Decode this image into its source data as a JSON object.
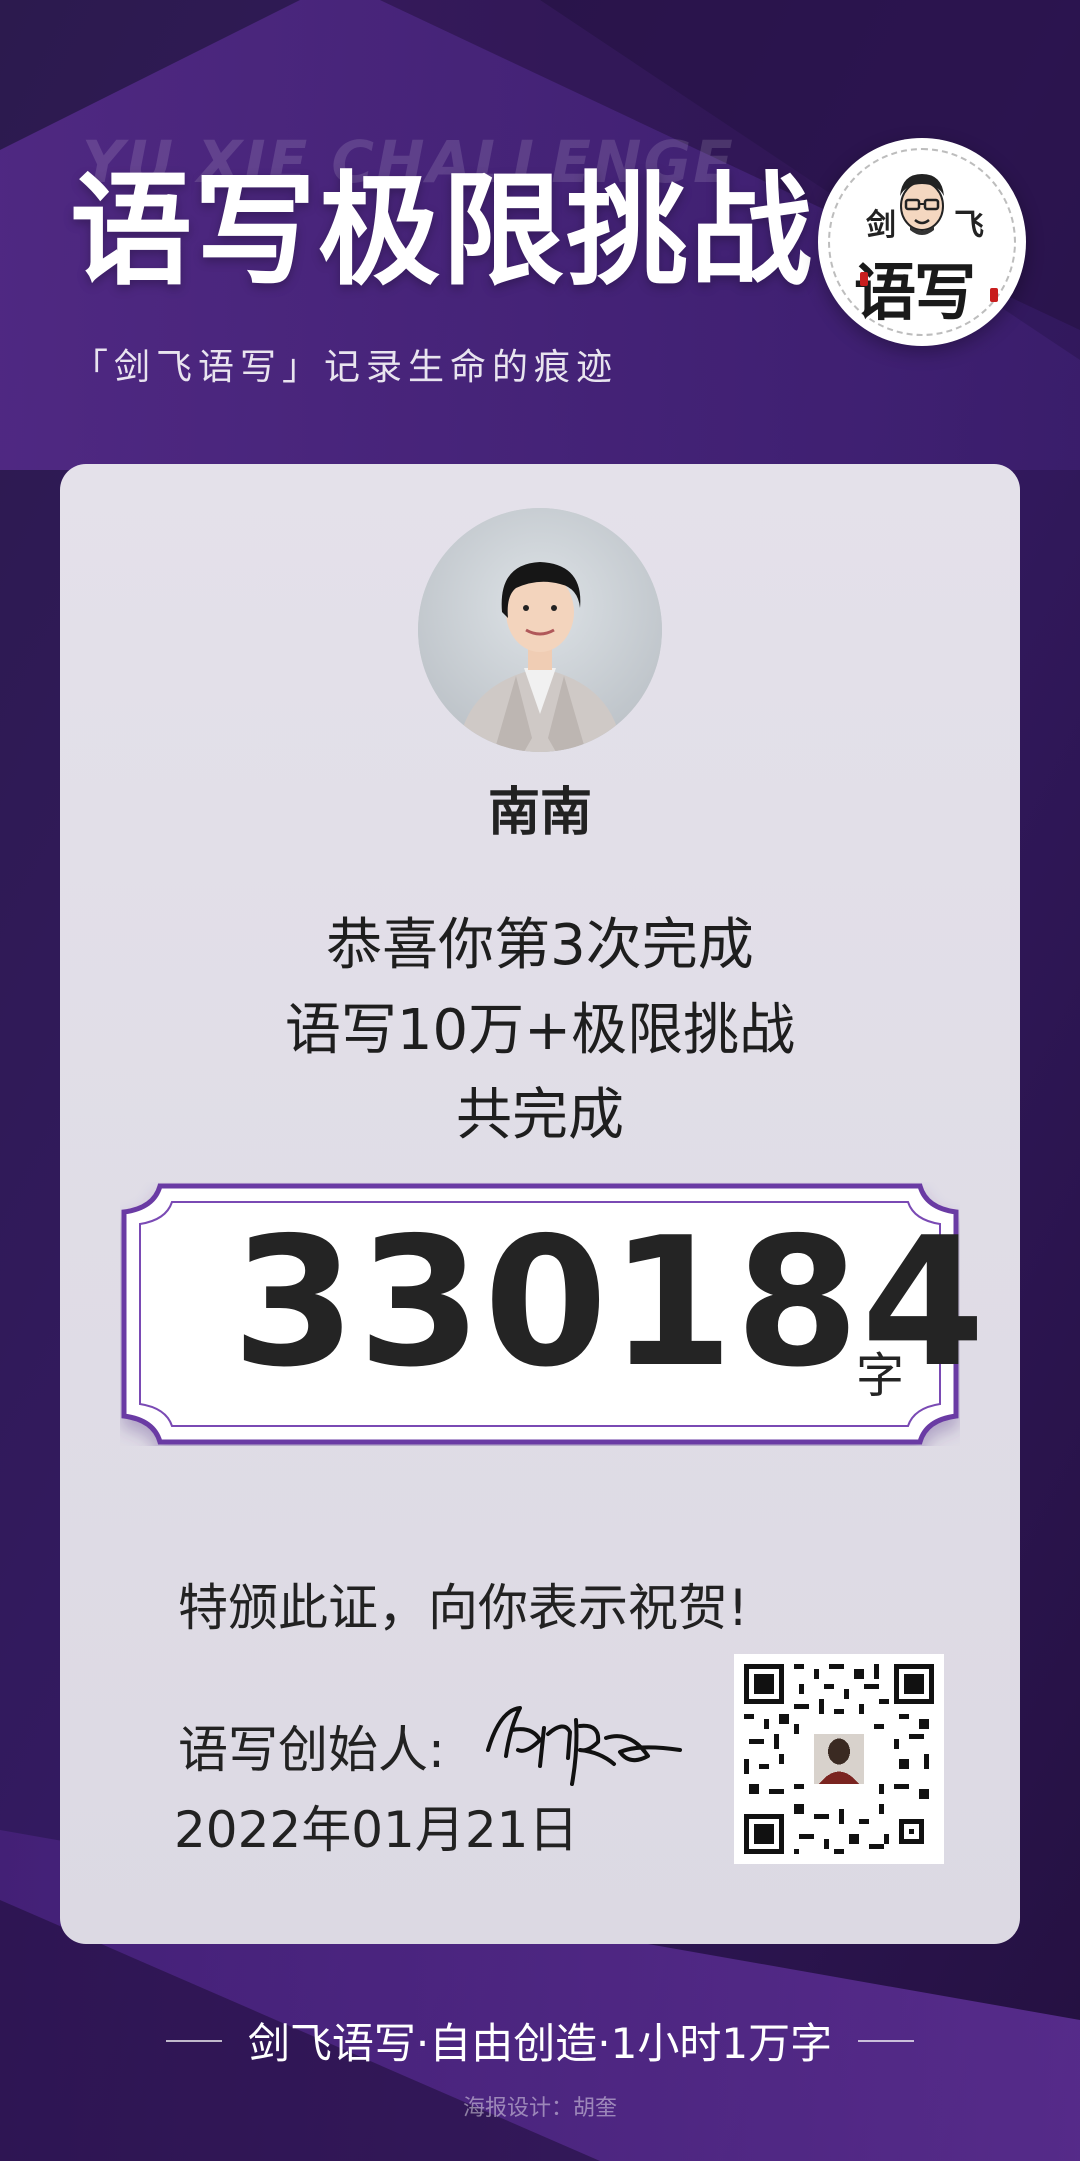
{
  "header": {
    "watermark": "YU XIE CHALLENGE",
    "title": "语写极限挑战",
    "subtitle": "「剑飞语写」记录生命的痕迹"
  },
  "logo": {
    "char_left": "剑",
    "char_right": "飞",
    "main_text": "语写"
  },
  "profile": {
    "name": "南南"
  },
  "message": {
    "line1": "恭喜你第3次完成",
    "line2": "语写10万+极限挑战",
    "line3": "共完成"
  },
  "total": {
    "count": "330184",
    "unit": "字"
  },
  "certificate": {
    "text": "特颁此证，向你表示祝贺!",
    "founder_label": "语写创始人:",
    "date": "2022年01月21日"
  },
  "footer": {
    "slogan": "剑飞语写·自由创造·1小时1万字",
    "credit": "海报设计：胡奎"
  },
  "colors": {
    "background_dark": "#2a1550",
    "accent_purple": "#6a3aa4",
    "card": "#e2dfe8",
    "logo_red": "#c81e1e"
  },
  "icons": {
    "logo": "jianfei-yuxie-logo",
    "qr": "qr-code",
    "signature": "founder-signature"
  }
}
